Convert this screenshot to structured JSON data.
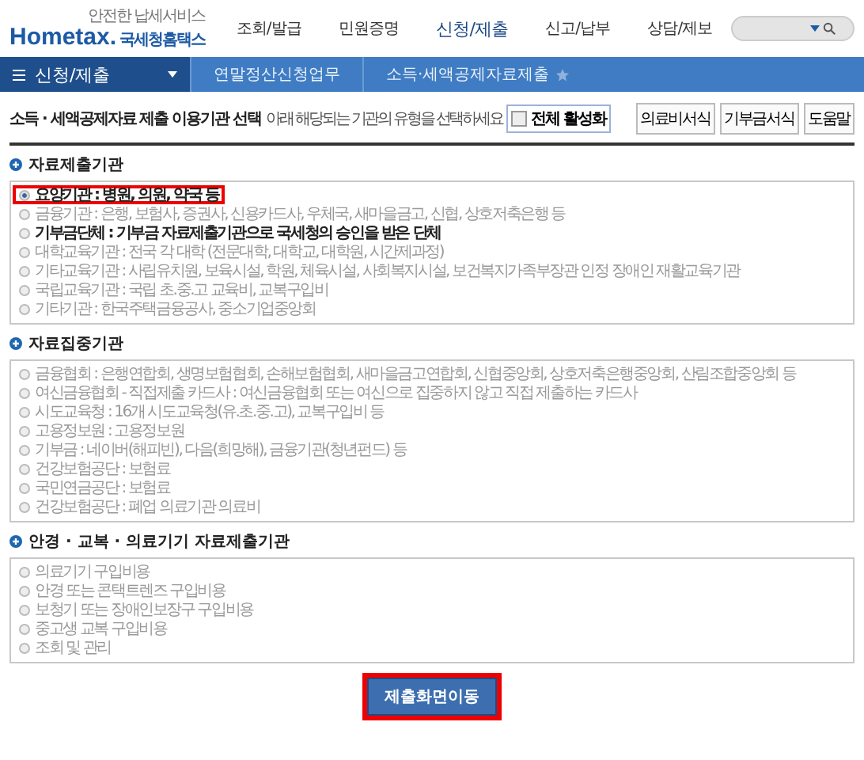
{
  "header": {
    "logo": {
      "slogan": "안전한 납세서비스",
      "brand": "Hometax.",
      "brand_ko": "국세청홈택스"
    },
    "menu": [
      {
        "label": "조회/발급",
        "selected": false
      },
      {
        "label": "민원증명",
        "selected": false
      },
      {
        "label": "신청/제출",
        "selected": true
      },
      {
        "label": "신고/납부",
        "selected": false
      },
      {
        "label": "상담/제보",
        "selected": false
      }
    ]
  },
  "breadcrumb": {
    "menu": "신청/제출",
    "items": [
      "연말정산신청업무",
      "소득·세액공제자료제출"
    ]
  },
  "page": {
    "title": "소득 · 세액공제자료 제출 이용기관 선택",
    "hint": "아래 해당되는 기관의 유형을 선택하세요",
    "enable_all": {
      "label": "전체 활성화",
      "checked": false
    },
    "buttons": [
      "의료비서식",
      "기부금서식",
      "도움말"
    ]
  },
  "sections": [
    {
      "title": "자료제출기관",
      "options": [
        {
          "label": "요양기관 : 병원, 의원, 약국 등",
          "selected": true,
          "disabled": false,
          "highlighted": true
        },
        {
          "label": "금융기관 : 은행, 보험사, 증권사, 신용카드사, 우체국, 새마을금고, 신협, 상호저축은행 등",
          "selected": false,
          "disabled": true,
          "highlighted": false
        },
        {
          "label": "기부금단체 : 기부금 자료제출기관으로 국세청의 승인을 받은 단체",
          "selected": false,
          "disabled": false,
          "highlighted": false
        },
        {
          "label": "대학교육기관 : 전국 각 대학 (전문대학, 대학교, 대학원, 시간제과정)",
          "selected": false,
          "disabled": true,
          "highlighted": false
        },
        {
          "label": "기타교육기관 : 사립유치원, 보육시설, 학원, 체육시설, 사회복지시설, 보건복지가족부장관 인정 장애인 재활교육기관",
          "selected": false,
          "disabled": true,
          "highlighted": false
        },
        {
          "label": "국립교육기관 : 국립 초.중.고 교육비, 교복구입비",
          "selected": false,
          "disabled": true,
          "highlighted": false
        },
        {
          "label": "기타기관 : 한국주택금융공사, 중소기업중앙회",
          "selected": false,
          "disabled": true,
          "highlighted": false
        }
      ]
    },
    {
      "title": "자료집중기관",
      "options": [
        {
          "label": "금융협회 : 은행연합회, 생명보험협회, 손해보험협회, 새마을금고연합회, 신협중앙회, 상호저축은행중앙회, 산림조합중앙회 등",
          "selected": false,
          "disabled": true,
          "highlighted": false
        },
        {
          "label": "여신금융협회 - 직접제출 카드사 : 여신금융협회 또는 여신으로 집중하지 않고 직접 제출하는 카드사",
          "selected": false,
          "disabled": true,
          "highlighted": false
        },
        {
          "label": "시도교육청 : 16개 시도교육청(유.초.중.고), 교복구입비 등",
          "selected": false,
          "disabled": true,
          "highlighted": false
        },
        {
          "label": "고용정보원 : 고용정보원",
          "selected": false,
          "disabled": true,
          "highlighted": false
        },
        {
          "label": "기부금 : 네이버(해피빈), 다음(희망해), 금융기관(청년펀드) 등",
          "selected": false,
          "disabled": true,
          "highlighted": false
        },
        {
          "label": "건강보험공단 : 보험료",
          "selected": false,
          "disabled": true,
          "highlighted": false
        },
        {
          "label": "국민연금공단 : 보험료",
          "selected": false,
          "disabled": true,
          "highlighted": false
        },
        {
          "label": "건강보험공단 : 폐업 의료기관 의료비",
          "selected": false,
          "disabled": true,
          "highlighted": false
        }
      ]
    },
    {
      "title": "안경 · 교복 · 의료기기 자료제출기관",
      "options": [
        {
          "label": "의료기기 구입비용",
          "selected": false,
          "disabled": true,
          "highlighted": false
        },
        {
          "label": "안경 또는 콘택트렌즈 구입비용",
          "selected": false,
          "disabled": true,
          "highlighted": false
        },
        {
          "label": "보청기 또는 장애인보장구 구입비용",
          "selected": false,
          "disabled": true,
          "highlighted": false
        },
        {
          "label": "중고생 교복 구입비용",
          "selected": false,
          "disabled": true,
          "highlighted": false
        },
        {
          "label": "조회 및 관리",
          "selected": false,
          "disabled": true,
          "highlighted": false
        }
      ]
    }
  ],
  "submit": {
    "label": "제출화면이동",
    "highlighted": true
  }
}
